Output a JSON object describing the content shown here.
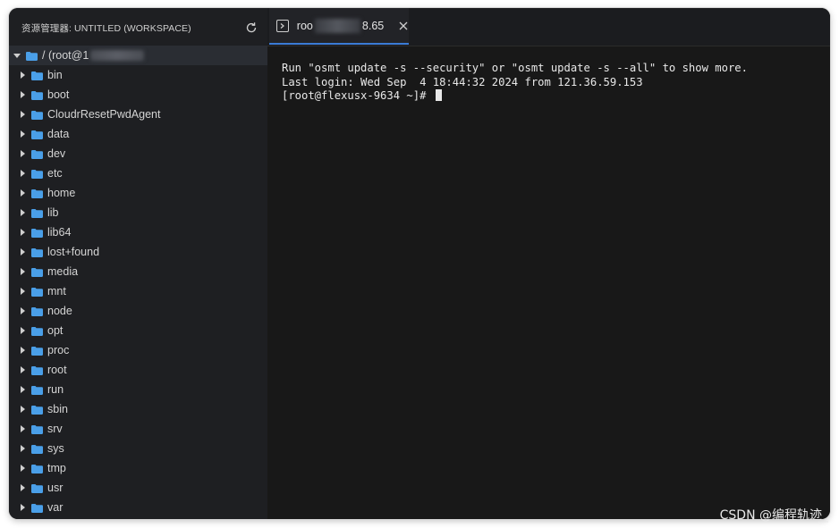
{
  "sidebar": {
    "title": "资源管理器: UNTITLED (WORKSPACE)",
    "root_label": "/ (root@1",
    "items": [
      {
        "label": "bin"
      },
      {
        "label": "boot"
      },
      {
        "label": "CloudrResetPwdAgent"
      },
      {
        "label": "data"
      },
      {
        "label": "dev"
      },
      {
        "label": "etc"
      },
      {
        "label": "home"
      },
      {
        "label": "lib"
      },
      {
        "label": "lib64"
      },
      {
        "label": "lost+found"
      },
      {
        "label": "media"
      },
      {
        "label": "mnt"
      },
      {
        "label": "node"
      },
      {
        "label": "opt"
      },
      {
        "label": "proc"
      },
      {
        "label": "root"
      },
      {
        "label": "run"
      },
      {
        "label": "sbin"
      },
      {
        "label": "srv"
      },
      {
        "label": "sys"
      },
      {
        "label": "tmp"
      },
      {
        "label": "usr"
      },
      {
        "label": "var"
      }
    ]
  },
  "tab": {
    "label_start": "roo",
    "label_end": "8.65"
  },
  "terminal": {
    "lines": [
      "Run \"osmt update -s --security\" or \"osmt update -s --all\" to show more.",
      "Last login: Wed Sep  4 18:44:32 2024 from 121.36.59.153",
      "[root@flexusx-9634 ~]# "
    ]
  },
  "watermark": "CSDN @编程轨迹_",
  "colors": {
    "folder": "#4a9fe8",
    "tab_accent": "#3a7bd5",
    "background": "#181818"
  },
  "icons": {
    "folder": "folder-icon",
    "refresh": "refresh-icon",
    "terminal": "terminal-icon",
    "close": "close-icon"
  }
}
